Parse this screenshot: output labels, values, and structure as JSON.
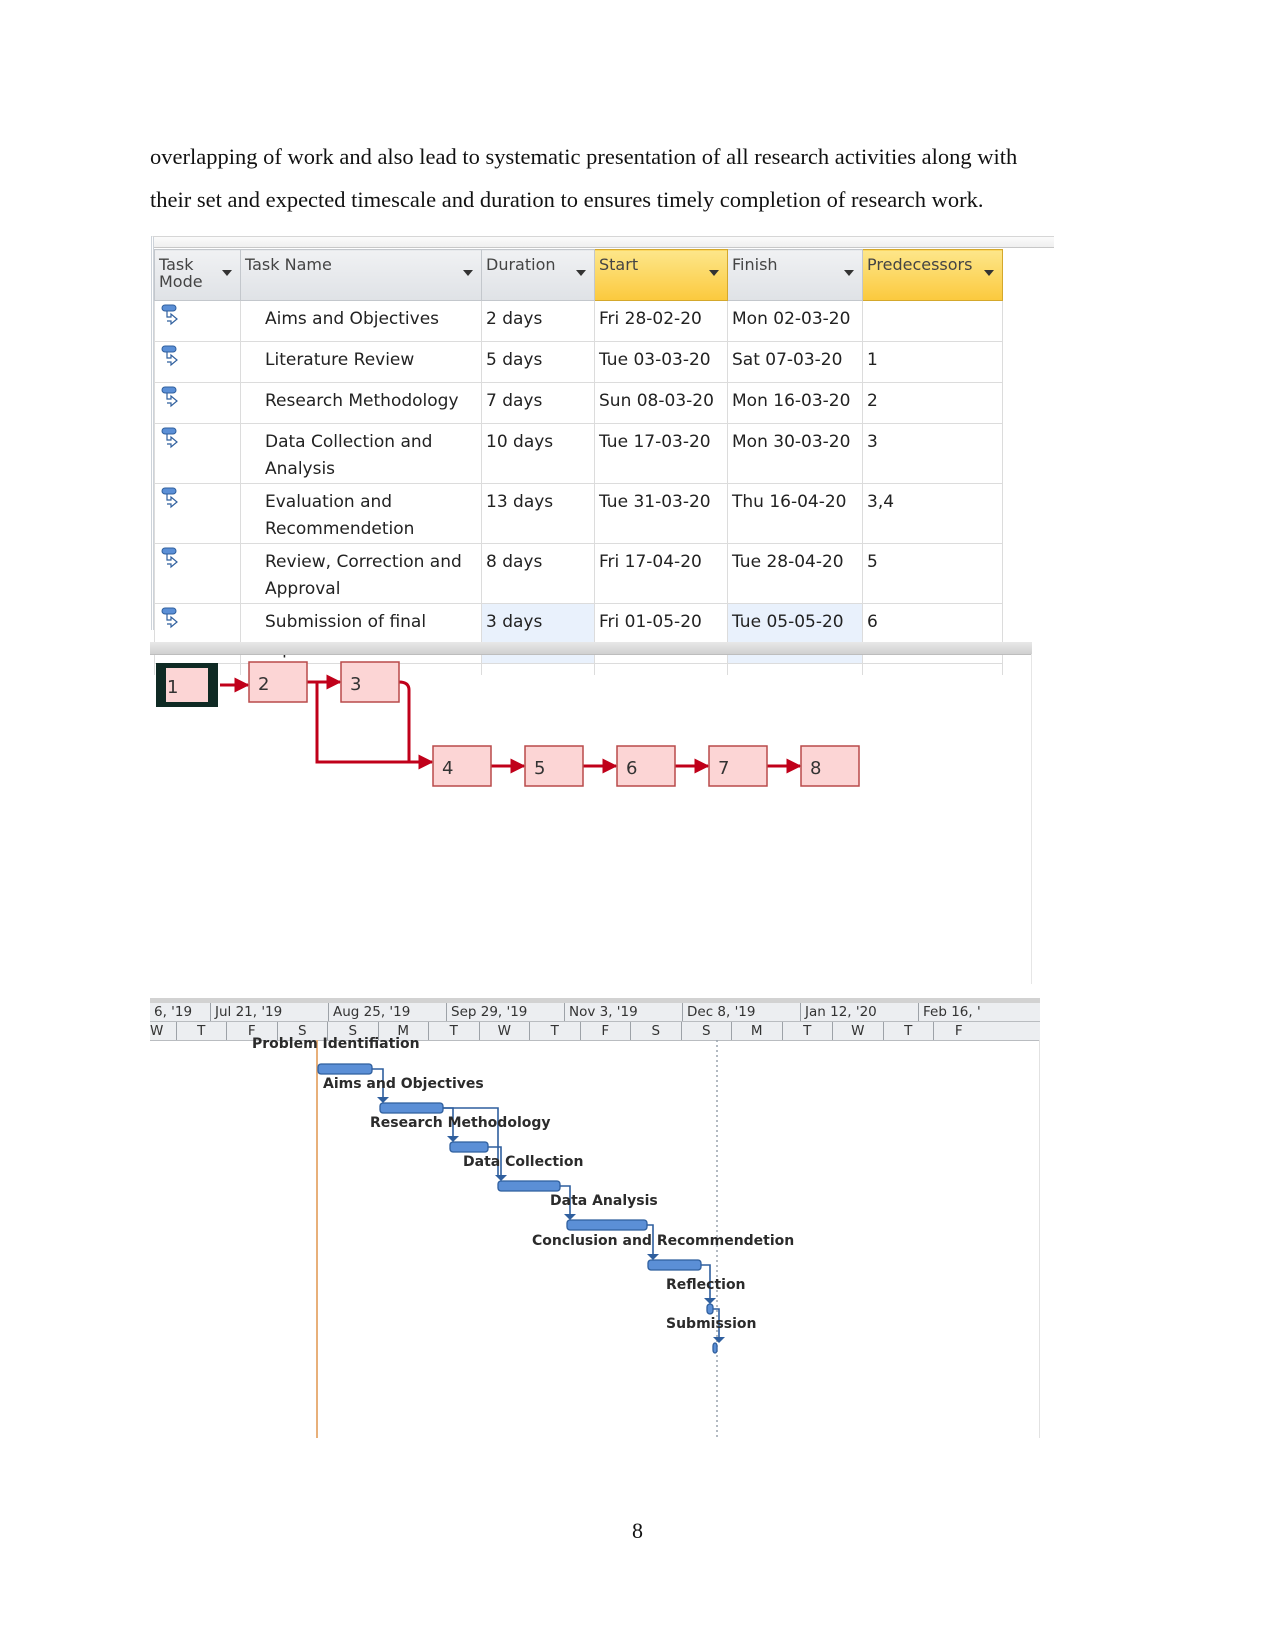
{
  "paragraph": {
    "lines": [
      "overlapping of work and also lead to systematic presentation of all research activities along with",
      "their set and expected timescale and duration to ensures timely completion of research work."
    ]
  },
  "task_table": {
    "headers": {
      "task_mode": "Task Mode",
      "task_mode_l1": "Task",
      "task_mode_l2": "Mode",
      "task_name": "Task Name",
      "duration": "Duration",
      "start": "Start",
      "finish": "Finish",
      "predecessors": "Predecessors"
    },
    "highlighted_columns": [
      "Start",
      "Predecessors"
    ],
    "task_mode_icon": "auto-scheduled-task-icon",
    "rows": [
      {
        "name": "Aims and Objectives",
        "name_l1": "Aims and Objectives",
        "name_l2": "",
        "duration": "2 days",
        "start": "Fri 28-02-20",
        "finish": "Mon 02-03-20",
        "predecessors": ""
      },
      {
        "name": "Literature Review",
        "name_l1": "Literature Review",
        "name_l2": "",
        "duration": "5 days",
        "start": "Tue 03-03-20",
        "finish": "Sat 07-03-20",
        "predecessors": "1"
      },
      {
        "name": "Research Methodology",
        "name_l1": "Research Methodology",
        "name_l2": "",
        "duration": "7 days",
        "start": "Sun 08-03-20",
        "finish": "Mon 16-03-20",
        "predecessors": "2"
      },
      {
        "name": "Data Collection and Analysis",
        "name_l1": "Data Collection and",
        "name_l2": "Analysis",
        "duration": "10 days",
        "start": "Tue 17-03-20",
        "finish": "Mon 30-03-20",
        "predecessors": "3"
      },
      {
        "name": "Evaluation and Recommendetion",
        "name_l1": "Evaluation and",
        "name_l2": "Recommendetion",
        "duration": "13 days",
        "start": "Tue 31-03-20",
        "finish": "Thu 16-04-20",
        "predecessors": "3,4"
      },
      {
        "name": "Review, Correction and Approval",
        "name_l1": "Review, Correction and",
        "name_l2": "Approval",
        "duration": "8 days",
        "start": "Fri 17-04-20",
        "finish": "Tue 28-04-20",
        "predecessors": "5"
      },
      {
        "name": "Submission of final report",
        "name_l1": "Submission of final",
        "name_l2": "report",
        "duration": "3 days",
        "start": "Fri 01-05-20",
        "finish": "Tue 05-05-20",
        "predecessors": "6"
      }
    ]
  },
  "network_diagram": {
    "colors": {
      "node_fill": "#fcd5d5",
      "node_border": "#b94a4a",
      "link": "#c0001a",
      "selected_border": "#0f2a24"
    },
    "nodes": [
      {
        "id": "1",
        "selected": true
      },
      {
        "id": "2"
      },
      {
        "id": "3"
      },
      {
        "id": "4"
      },
      {
        "id": "5"
      },
      {
        "id": "6"
      },
      {
        "id": "7"
      },
      {
        "id": "8"
      }
    ],
    "links": [
      [
        "1",
        "2"
      ],
      [
        "2",
        "3"
      ],
      [
        "2",
        "4"
      ],
      [
        "3",
        "4"
      ],
      [
        "4",
        "5"
      ],
      [
        "5",
        "6"
      ],
      [
        "6",
        "7"
      ],
      [
        "7",
        "8"
      ]
    ]
  },
  "gantt": {
    "timescale_top": [
      "6, '19",
      "Jul 21, '19",
      "Aug 25, '19",
      "Sep 29, '19",
      "Nov 3, '19",
      "Dec 8, '19",
      "Jan 12, '20",
      "Feb 16, '"
    ],
    "timescale_bottom": [
      "W",
      "T",
      "F",
      "S",
      "S",
      "M",
      "T",
      "W",
      "T",
      "F",
      "S",
      "S",
      "M",
      "T",
      "W",
      "T",
      "F"
    ],
    "colors": {
      "bar": "#5b8fd6",
      "bar_border": "#2f5f9e",
      "link": "#2f5f9e",
      "project_start_line": "#e8b07a",
      "status_line": "#9aa3ad"
    },
    "tasks": [
      {
        "label": "Problem Identifiation"
      },
      {
        "label": "Aims and Objectives"
      },
      {
        "label": "Research Methodology"
      },
      {
        "label": "Data Collection"
      },
      {
        "label": "Data Analysis"
      },
      {
        "label": "Conclusion and Recommendetion"
      },
      {
        "label": "Reflection"
      },
      {
        "label": "Submission"
      }
    ]
  },
  "page_number": "8"
}
